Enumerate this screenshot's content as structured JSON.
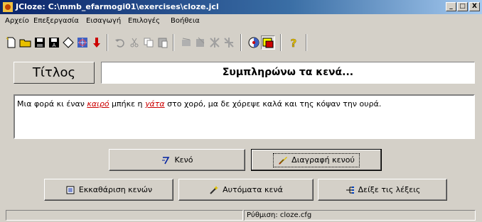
{
  "window": {
    "title": "JCloze: C:\\mmb_efarmogi01\\exercises\\cloze.jcl",
    "minimize": "_",
    "maximize": "□",
    "close": "X"
  },
  "menu": [
    "Αρχείο",
    "Επεξεργασία",
    "Εισαγωγή",
    "Επιλογές",
    "Βοήθεια"
  ],
  "toolbar": {
    "icons": [
      "new-file-icon",
      "open-folder-icon",
      "save-icon",
      "save-as-icon",
      "eraser-icon",
      "web-export-icon",
      "down-arrow-icon",
      "undo-icon",
      "cut-icon",
      "copy-icon",
      "paste-icon",
      "tool-disabled-1-icon",
      "tool-disabled-2-icon",
      "tool-disabled-3-icon",
      "tool-disabled-4-icon",
      "config-icon",
      "view-icon",
      "help-icon"
    ]
  },
  "exercise": {
    "title_label": "Τίτλος",
    "title_value": "Συμπληρώνω τα κενά...",
    "text_before": "Μια φορά κι έναν ",
    "gap1": "καιρό",
    "text_middle": " μπήκε η ",
    "gap2": "γάτα",
    "text_after": " στο χορό, μα δε χόρεψε καλά και της κόψαν την ουρά."
  },
  "buttons": {
    "gap": "Κενό",
    "delete_gap": "Διαγραφή κενού",
    "clear_gaps": "Εκκαθάριση κενών",
    "auto_gaps": "Αυτόματα κενά",
    "show_words": "Δείξε τις λέξεις"
  },
  "status": {
    "pane1": "",
    "pane2": "Ρύθμιση: cloze.cfg"
  },
  "colors": {
    "titlebar": "#0a246a",
    "gap_text": "#cc0000",
    "face": "#d4d0c8"
  }
}
